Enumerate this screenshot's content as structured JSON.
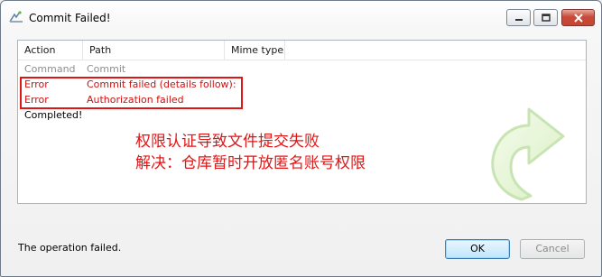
{
  "window": {
    "title": "Commit Failed!",
    "icon": "tortoisesvn-commit-icon",
    "controls": {
      "minimize": "minimize-icon",
      "maximize": "maximize-icon",
      "close": "close-icon"
    }
  },
  "list": {
    "columns": [
      "Action",
      "Path",
      "Mime type"
    ],
    "rows": [
      {
        "action": "Command",
        "path": "Commit"
      },
      {
        "action": "Error",
        "path": "Commit failed (details follow):"
      },
      {
        "action": "Error",
        "path": "Authorization failed"
      },
      {
        "action": "Completed!",
        "path": ""
      }
    ]
  },
  "annotations": {
    "line1": "权限认证导致文件提交失败",
    "line2": "解决：仓库暂时开放匿名账号权限"
  },
  "status": "The operation failed.",
  "buttons": {
    "ok": "OK",
    "cancel": "Cancel"
  },
  "colors": {
    "error": "#cc1111",
    "annotation": "#e01515",
    "muted": "#8e8e8e"
  }
}
